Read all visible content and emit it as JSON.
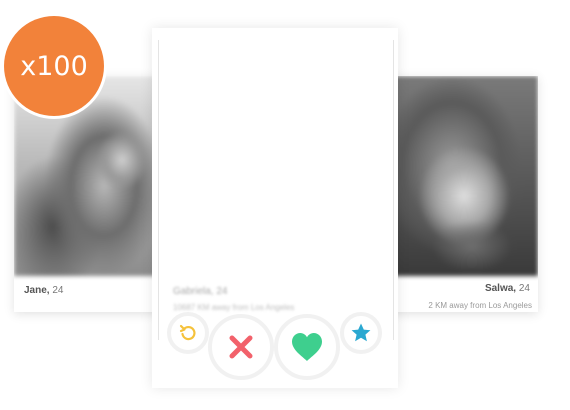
{
  "badge": {
    "label": "x100",
    "color": "#f2823a"
  },
  "cards": {
    "left": {
      "name": "Jane,",
      "age": "24",
      "photo": "portrait-photo"
    },
    "center": {
      "name": "Gabriela, 24",
      "distance": "10687 KM away from Los Angeles"
    },
    "right": {
      "name": "Salwa,",
      "age": "24",
      "distance": "2 KM away from Los Angeles",
      "photo": "portrait-photo"
    }
  },
  "actions": {
    "undo": {
      "icon": "undo-icon",
      "color": "#f5c23b"
    },
    "nope": {
      "icon": "x-icon",
      "color": "#f2616b"
    },
    "like": {
      "icon": "heart-icon",
      "color": "#3ecf8e"
    },
    "super_like": {
      "icon": "star-icon",
      "color": "#2aa8d1"
    }
  }
}
